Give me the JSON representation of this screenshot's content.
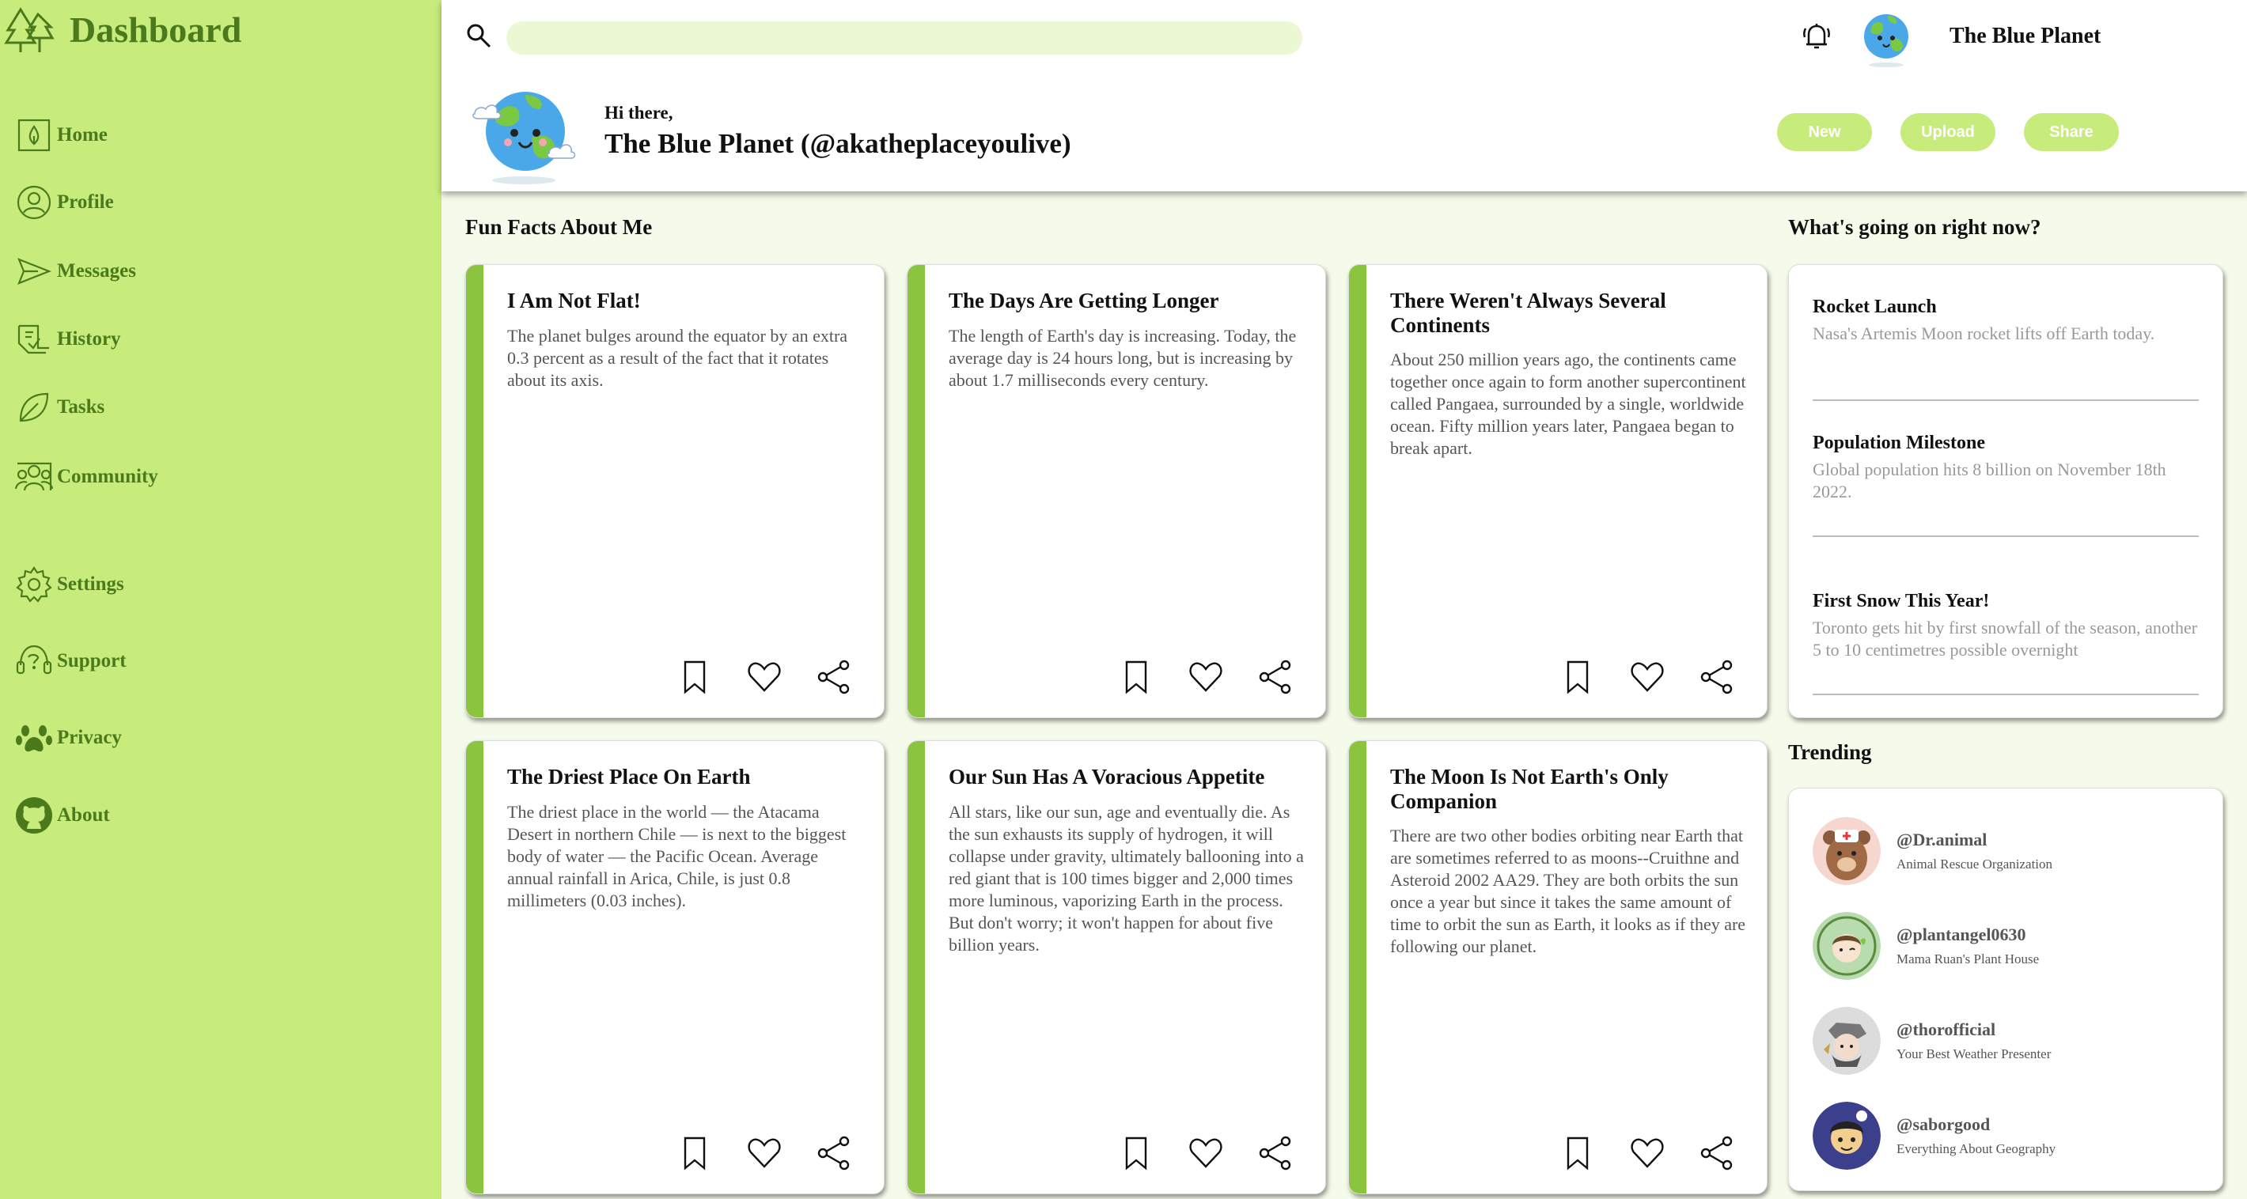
{
  "sidebar": {
    "logo_text": "Dashboard",
    "items": [
      {
        "label": "Home",
        "icon": "home-icon"
      },
      {
        "label": "Profile",
        "icon": "profile-icon"
      },
      {
        "label": "Messages",
        "icon": "messages-icon"
      },
      {
        "label": "History",
        "icon": "history-icon"
      },
      {
        "label": "Tasks",
        "icon": "tasks-icon"
      },
      {
        "label": "Community",
        "icon": "community-icon"
      },
      {
        "label": "Settings",
        "icon": "settings-icon"
      },
      {
        "label": "Support",
        "icon": "support-icon"
      },
      {
        "label": "Privacy",
        "icon": "privacy-icon"
      },
      {
        "label": "About",
        "icon": "github-icon"
      }
    ]
  },
  "header": {
    "search_placeholder": "",
    "user_name": "The Blue Planet",
    "greeting": "Hi there,",
    "user_display": "The Blue Planet (@akatheplaceyoulive)",
    "buttons": {
      "new": "New",
      "upload": "Upload",
      "share": "Share"
    }
  },
  "facts": {
    "title": "Fun Facts About Me",
    "cards": [
      {
        "title": "I Am Not Flat!",
        "text": "The planet bulges around the equator by an extra 0.3 percent as a result of the fact that it rotates about its axis."
      },
      {
        "title": "The Days Are Getting Longer",
        "text": "The length of Earth's day is increasing. Today, the average day is 24 hours long, but is increasing by about 1.7 milliseconds every century."
      },
      {
        "title": "There Weren't Always Several Continents",
        "text": "About 250 million years ago, the continents came together once again to form another supercontinent called Pangaea, surrounded by a single, worldwide ocean. Fifty million years later, Pangaea began to break apart."
      },
      {
        "title": "The Driest Place On Earth",
        "text": "The driest place in the world — the Atacama Desert in northern Chile — is next to the biggest body of water — the Pacific Ocean. Average annual rainfall in Arica, Chile, is just 0.8 millimeters (0.03 inches)."
      },
      {
        "title": "Our Sun Has A Voracious Appetite",
        "text": "All stars, like our sun, age and eventually die. As the sun exhausts its supply of hydrogen, it will collapse under gravity, ultimately ballooning into a red giant that is 100 times bigger and 2,000 times more luminous, vaporizing Earth in the process. But don't worry; it won't happen for about five billion years."
      },
      {
        "title": "The Moon Is Not Earth's Only Companion",
        "text": "There are two other bodies orbiting near Earth that are sometimes referred to as moons--Cruithne and Asteroid 2002 AA29. They are both orbits the sun once a year but since it takes the same amount of time to orbit the sun as Earth, it looks as if they are following our planet."
      }
    ]
  },
  "news": {
    "title": "What's going on right now?",
    "items": [
      {
        "title": "Rocket Launch",
        "text": "Nasa's Artemis Moon rocket lifts off Earth today."
      },
      {
        "title": "Population Milestone",
        "text": "Global population hits 8 billion on November 18th 2022."
      },
      {
        "title": "First Snow This Year!",
        "text": "Toronto gets hit by first snowfall of the season, another 5 to 10 centimetres possible overnight"
      }
    ]
  },
  "trending": {
    "title": "Trending",
    "items": [
      {
        "handle": "@Dr.animal",
        "subtitle": "Animal Rescue Organization"
      },
      {
        "handle": "@plantangel0630",
        "subtitle": "Mama Ruan's Plant House"
      },
      {
        "handle": "@thorofficial",
        "subtitle": "Your Best Weather Presenter"
      },
      {
        "handle": "@saborgood",
        "subtitle": "Everything About Geography"
      }
    ]
  },
  "colors": {
    "sidebar": "#c7ec7c",
    "accent": "#8bc53f",
    "text_green": "#4a7a1c"
  }
}
